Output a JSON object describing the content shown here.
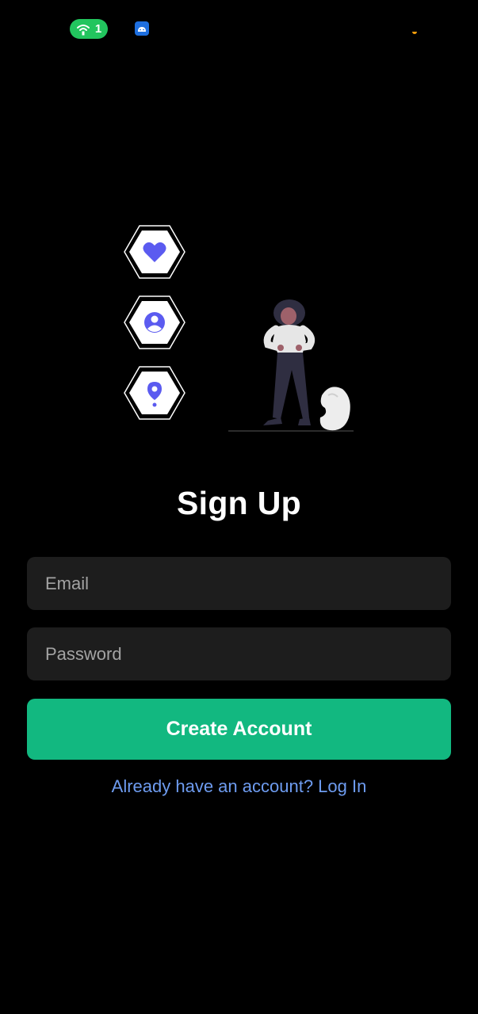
{
  "status_bar": {
    "hotspot_count": "1",
    "hotspot_color": "#22c55e",
    "icons": [
      "wifi-hotspot-icon",
      "android-app-icon"
    ]
  },
  "features": {
    "icons": [
      "heart-icon",
      "user-profile-icon",
      "location-pin-icon"
    ],
    "accent_color": "#5b5bf0"
  },
  "signup": {
    "title": "Sign Up",
    "email_placeholder": "Email",
    "password_placeholder": "Password",
    "create_button_label": "Create Account",
    "login_link_label": "Already have an account? Log In"
  },
  "colors": {
    "background": "#000000",
    "field_background": "#1d1d1d",
    "primary_button": "#12b880",
    "link": "#6e9cf0"
  }
}
